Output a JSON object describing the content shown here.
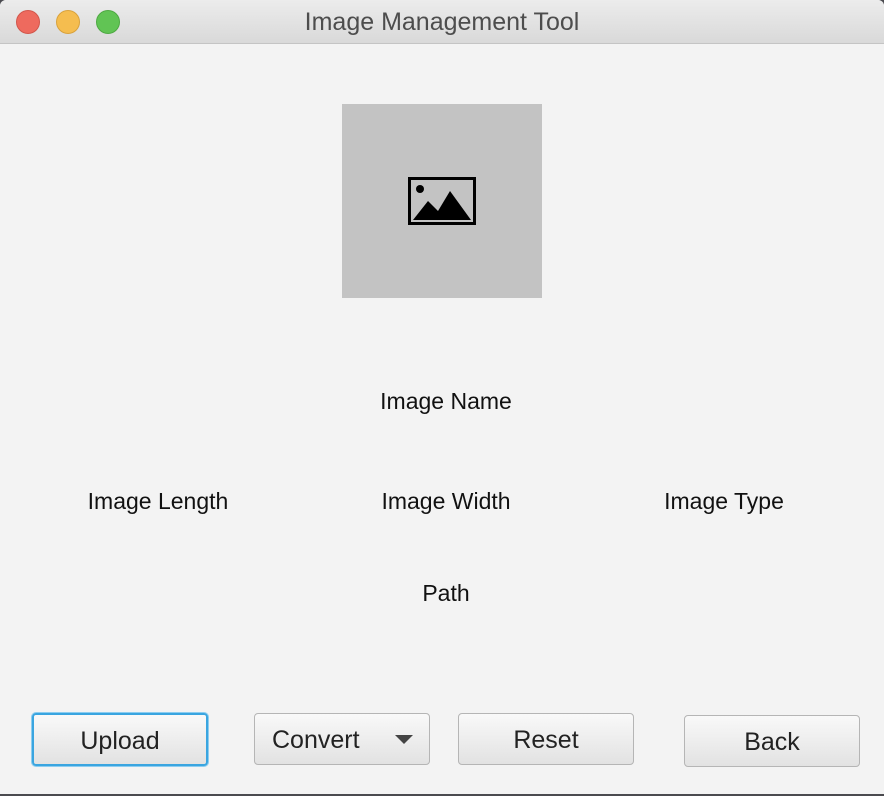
{
  "window": {
    "title": "Image Management Tool"
  },
  "preview": {
    "icon": "image-placeholder-icon"
  },
  "info": {
    "name_label": "Image Name",
    "length_label": "Image Length",
    "width_label": "Image Width",
    "type_label": "Image Type",
    "path_label": "Path"
  },
  "buttons": {
    "upload": "Upload",
    "convert": "Convert",
    "reset": "Reset",
    "back": "Back"
  },
  "colors": {
    "focus_ring": "#3aa5e0",
    "close": "#ee6a5e",
    "minimize": "#f5bd4f",
    "maximize": "#61c454"
  }
}
